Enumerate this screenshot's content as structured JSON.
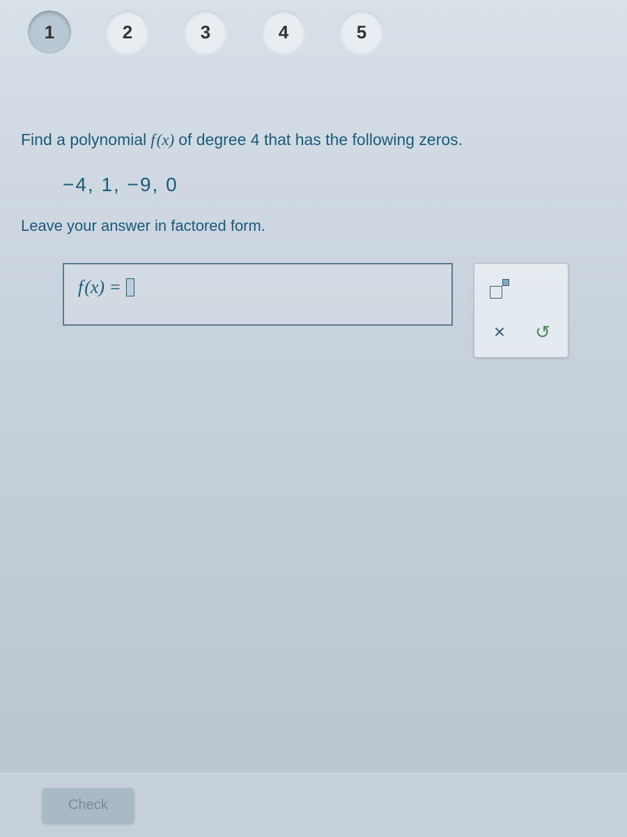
{
  "tabs": {
    "items": [
      "1",
      "2",
      "3",
      "4",
      "5"
    ],
    "activeIndex": 0
  },
  "question": {
    "part1": "Find a polynomial",
    "fn": "f",
    "paren_x": "(x)",
    "part2": "of degree 4 that has the following zeros."
  },
  "zeros": "−4, 1, −9, 0",
  "instruction": "Leave your answer in factored form.",
  "answer": {
    "fn": "f",
    "paren_x": "(x)",
    "equals": "="
  },
  "tools": {
    "exponent": "exponent",
    "clear": "×",
    "reset": "↺"
  },
  "footer": {
    "check": "Check"
  }
}
